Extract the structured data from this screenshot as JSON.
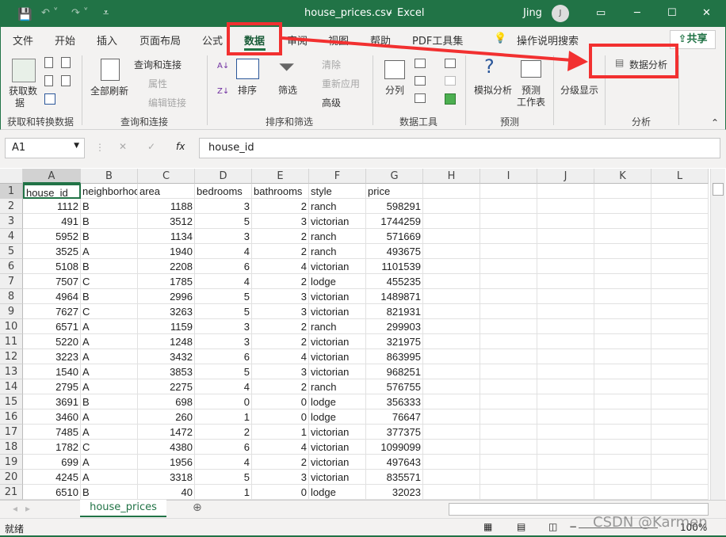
{
  "title": {
    "filename": "house_prices.csv",
    "separator": "-",
    "app": "Excel",
    "user": "Jing",
    "avatar_letter": "J"
  },
  "tabs": [
    "文件",
    "开始",
    "插入",
    "页面布局",
    "公式",
    "数据",
    "审阅",
    "视图",
    "帮助",
    "PDF工具集"
  ],
  "active_tab": "数据",
  "tell_me": "操作说明搜索",
  "share": "共享",
  "ribbon": {
    "get_data": "获取数",
    "get_data2": "据",
    "group1": "获取和转换数据",
    "refresh_all": "全部刷新",
    "queries": "查询和连接",
    "properties": "属性",
    "edit_links": "编辑链接",
    "group2": "查询和连接",
    "sort": "排序",
    "filter": "筛选",
    "clear": "清除",
    "reapply": "重新应用",
    "advanced": "高级",
    "group3": "排序和筛选",
    "text_to_cols": "分列",
    "group4": "数据工具",
    "what_if": "模拟分析",
    "forecast1": "预测",
    "forecast2": "工作表",
    "group5": "预测",
    "outline": "分级显示",
    "data_analysis": "数据分析",
    "group6": "分析"
  },
  "name_box": "A1",
  "fx": "fx",
  "formula": "house_id",
  "columns": [
    "A",
    "B",
    "C",
    "D",
    "E",
    "F",
    "G",
    "H",
    "I",
    "J",
    "K",
    "L"
  ],
  "header_row": [
    "house_id",
    "neighborhood",
    "area",
    "bedrooms",
    "bathrooms",
    "style",
    "price"
  ],
  "rows": [
    [
      "1112",
      "B",
      "1188",
      "3",
      "2",
      "ranch",
      "598291"
    ],
    [
      "491",
      "B",
      "3512",
      "5",
      "3",
      "victorian",
      "1744259"
    ],
    [
      "5952",
      "B",
      "1134",
      "3",
      "2",
      "ranch",
      "571669"
    ],
    [
      "3525",
      "A",
      "1940",
      "4",
      "2",
      "ranch",
      "493675"
    ],
    [
      "5108",
      "B",
      "2208",
      "6",
      "4",
      "victorian",
      "1101539"
    ],
    [
      "7507",
      "C",
      "1785",
      "4",
      "2",
      "lodge",
      "455235"
    ],
    [
      "4964",
      "B",
      "2996",
      "5",
      "3",
      "victorian",
      "1489871"
    ],
    [
      "7627",
      "C",
      "3263",
      "5",
      "3",
      "victorian",
      "821931"
    ],
    [
      "6571",
      "A",
      "1159",
      "3",
      "2",
      "ranch",
      "299903"
    ],
    [
      "5220",
      "A",
      "1248",
      "3",
      "2",
      "victorian",
      "321975"
    ],
    [
      "3223",
      "A",
      "3432",
      "6",
      "4",
      "victorian",
      "863995"
    ],
    [
      "1540",
      "A",
      "3853",
      "5",
      "3",
      "victorian",
      "968251"
    ],
    [
      "2795",
      "A",
      "2275",
      "4",
      "2",
      "ranch",
      "576755"
    ],
    [
      "3691",
      "B",
      "698",
      "0",
      "0",
      "lodge",
      "356333"
    ],
    [
      "3460",
      "A",
      "260",
      "1",
      "0",
      "lodge",
      "76647"
    ],
    [
      "7485",
      "A",
      "1472",
      "2",
      "1",
      "victorian",
      "377375"
    ],
    [
      "1782",
      "C",
      "4380",
      "6",
      "4",
      "victorian",
      "1099099"
    ],
    [
      "699",
      "A",
      "1956",
      "4",
      "2",
      "victorian",
      "497643"
    ],
    [
      "4245",
      "A",
      "3318",
      "5",
      "3",
      "victorian",
      "835571"
    ],
    [
      "6510",
      "B",
      "40",
      "1",
      "0",
      "lodge",
      "32023"
    ]
  ],
  "sheet_tab": "house_prices",
  "status": "就绪",
  "zoom": "100%",
  "watermark": "CSDN @Karmen",
  "colors": {
    "excel_green": "#217346",
    "annotation_red": "#f23030"
  }
}
